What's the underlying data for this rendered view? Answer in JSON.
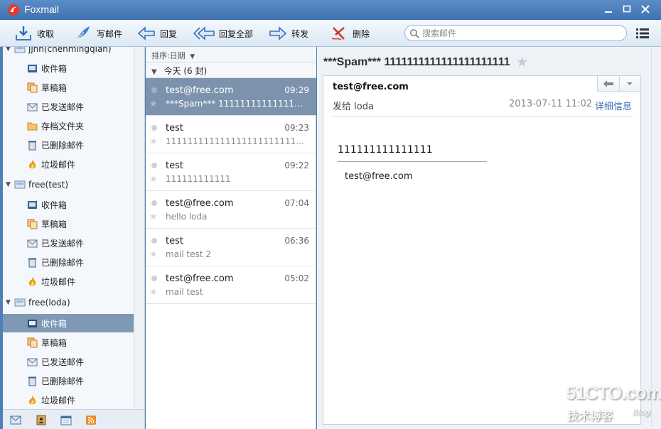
{
  "window": {
    "title": "Foxmail"
  },
  "toolbar": {
    "receive": "收取",
    "compose": "写邮件",
    "reply": "回复",
    "reply_all": "回复全部",
    "forward": "转发",
    "delete": "删除",
    "search_placeholder": "搜索邮件"
  },
  "accounts": [
    {
      "name": "jjhh(chenmingqian)",
      "folders": [
        "收件箱",
        "草稿箱",
        "已发送邮件",
        "存档文件夹",
        "已删除邮件",
        "垃圾邮件"
      ]
    },
    {
      "name": "free(test)",
      "folders": [
        "收件箱",
        "草稿箱",
        "已发送邮件",
        "已删除邮件",
        "垃圾邮件"
      ]
    },
    {
      "name": "free(loda)",
      "folders": [
        "收件箱",
        "草稿箱",
        "已发送邮件",
        "已删除邮件",
        "垃圾邮件"
      ],
      "selected_folder": "收件箱"
    }
  ],
  "list": {
    "sort_label": "排序:日期",
    "group_label": "今天 (6 封)",
    "messages": [
      {
        "from": "test@free.com",
        "time": "09:29",
        "subject": "***Spam*** 1111111111111111111111",
        "selected": true
      },
      {
        "from": "test",
        "time": "09:23",
        "subject": "1111111111111111111111111111111"
      },
      {
        "from": "test",
        "time": "09:22",
        "subject": "111111111111"
      },
      {
        "from": "test@free.com",
        "time": "07:04",
        "subject": "hello loda"
      },
      {
        "from": "test",
        "time": "06:36",
        "subject": "mail test 2"
      },
      {
        "from": "test@free.com",
        "time": "05:02",
        "subject": "mail test"
      }
    ]
  },
  "reader": {
    "subject": "***Spam*** 1111111111111111111111",
    "sender": "test@free.com",
    "to": "发给 loda",
    "date": "2013-07-11 11:02",
    "details_link": "详细信息",
    "body_line1": "111111111111111",
    "body_line2": "test@free.com"
  },
  "watermark": {
    "site": "51CTO.com",
    "tagline": "技术博客",
    "blog": "Blog"
  },
  "colors": {
    "titlebar": "#4a7dbb",
    "selection": "#7d93ad",
    "link": "#3b6fb0"
  }
}
